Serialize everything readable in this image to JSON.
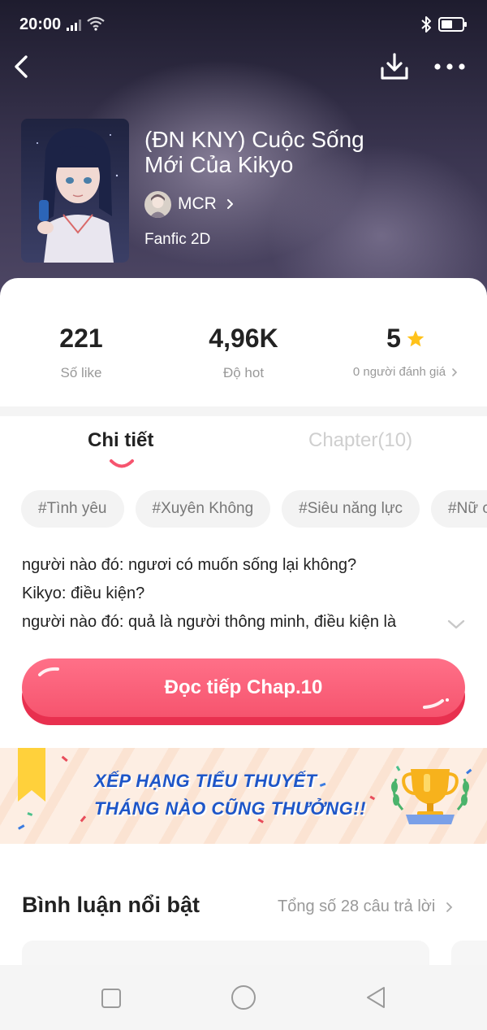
{
  "status_bar": {
    "time": "20:00"
  },
  "book": {
    "title_line1": "(ĐN KNY) Cuộc Sống",
    "title_line2": "Mới Của Kikyo",
    "author": "MCR",
    "genre": "Fanfic 2D"
  },
  "stats": {
    "likes_value": "221",
    "likes_label": "Số like",
    "hot_value": "4,96K",
    "hot_label": "Độ hot",
    "rating_value": "5",
    "rating_label": "0 người đánh giá"
  },
  "tabs": {
    "detail": "Chi tiết",
    "chapter": "Chapter(10)"
  },
  "tags": [
    "#Tình yêu",
    "#Xuyên Không",
    "#Siêu năng lực",
    "#Nữ cường"
  ],
  "description": {
    "line1": "người nào đó: ngươi có muốn sống lại không?",
    "line2": "Kikyo: điều kiện?",
    "line3": "người nào đó: quả là người thông minh, điều kiện là"
  },
  "read_button": "Đọc tiếp Chap.10",
  "banner": {
    "line1": "XẾP HẠNG TIỂU THUYẾT",
    "line2": "THÁNG NÀO CŨNG THƯỞNG!!"
  },
  "comments": {
    "title": "Bình luận nổi bật",
    "total": "Tổng số 28 câu trả lời"
  },
  "colors": {
    "accent_pink": "#f6546e",
    "star_yellow": "#ffc21a",
    "banner_blue": "#1e56c8"
  }
}
